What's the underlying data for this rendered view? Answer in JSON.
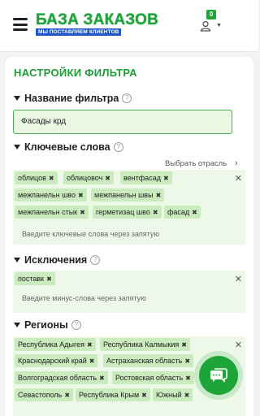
{
  "header": {
    "logo_main": "БАЗА ЗАКАЗОВ",
    "logo_sub": "МЫ ПОСТАВЛЯЕМ КЛИЕНТОВ",
    "notification_count": "0",
    "icons": [
      "menu-icon",
      "user-icon",
      "caret-down-icon"
    ]
  },
  "filter": {
    "title": "НАСТРОЙКИ ФИЛЬТРА",
    "name_section": {
      "label": "Название фильтра",
      "value": "Фасады крд"
    },
    "keywords_section": {
      "label": "Ключевые слова",
      "choose_label": "Выбрать отрасль",
      "chips": [
        "облицов",
        "облицовоч",
        "вентфасад",
        "межпанельн шво",
        "межпанельн швы",
        "межпанельн стык",
        "герметизац шво",
        "фасад"
      ],
      "placeholder": "Введите ключевые слова через запятую"
    },
    "exclusions_section": {
      "label": "Исключения",
      "chips": [
        "поставк"
      ],
      "placeholder": "Введите минус-слова через запятую"
    },
    "regions_section": {
      "label": "Регионы",
      "chips": [
        "Республика Адыгея",
        "Республика Калмыкия",
        "Краснодарский край",
        "Астраханская область",
        "Волгоградская область",
        "Ростовская область",
        "Севастополь",
        "Республика Крым",
        "Южный"
      ]
    }
  },
  "colors": {
    "brand_green": "#1ea539",
    "title_green": "#1e9b38",
    "chip_green": "#c9ebbd",
    "box_bg": "#eef8e9",
    "logo_blue": "#1e56c7"
  }
}
